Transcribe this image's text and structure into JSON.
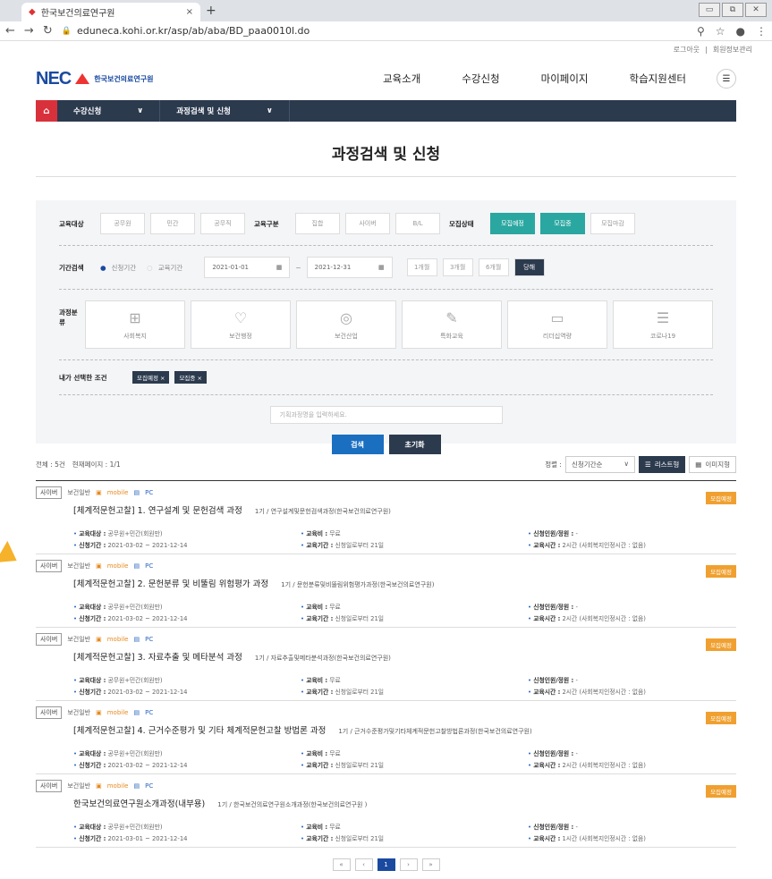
{
  "browser": {
    "tab_title": "한국보건의료연구원",
    "tab_close": "×",
    "new_tab": "+",
    "url": "eduneca.kohi.or.kr/asp/ab/aba/BD_paa0010l.do",
    "win_buttons": [
      "▭",
      "⧉",
      "✕"
    ]
  },
  "util": {
    "logout": "로그아웃",
    "sep": "|",
    "mypage": "회원정보관리"
  },
  "header": {
    "logo_text": "NEC",
    "logo_kor": "한국보건의료연구원",
    "menu": [
      "교육소개",
      "수강신청",
      "마이페이지",
      "학습지원센터"
    ]
  },
  "lnb": {
    "home": "⌂",
    "items": [
      "수강신청",
      "과정검색 및 신청"
    ],
    "chev": "∨"
  },
  "page_title": "과정검색 및 신청",
  "filter": {
    "target_label": "교육대상",
    "target_opts": [
      "공무원",
      "민간",
      "공무직"
    ],
    "type_label": "교육구분",
    "type_opts": [
      "집합",
      "사이버",
      "B/L"
    ],
    "status_label": "모집상태",
    "status_opts": [
      "모집예정",
      "모집중",
      "모집마감"
    ],
    "period_label": "기간검색",
    "period_radio1": "신청기간",
    "period_radio2": "교육기간",
    "date_from": "2021-01-01",
    "date_sep": "~",
    "date_to": "2021-12-31",
    "range_opts": [
      "1개월",
      "3개월",
      "6개월",
      "당해"
    ],
    "cat_label": "과정분류",
    "cats": [
      "사회복지",
      "보건행정",
      "보건산업",
      "특화교육",
      "리더십역량",
      "코로나19"
    ],
    "selected_label": "내가 선택한 조건",
    "chips": [
      "모집예정 ×",
      "모집중 ×"
    ],
    "search_placeholder": "기획과정명을 입력하세요.",
    "search_btn": "검색",
    "reset_btn": "초기화"
  },
  "listbar": {
    "total": "전체 : 5건",
    "page_info": "현재페이지 : 1/1",
    "sort_label": "정렬 :",
    "sort_value": "신청기간순",
    "view_list": "리스트형",
    "view_image": "이미지형"
  },
  "common": {
    "tag": "사이버",
    "category": "보건일반",
    "mobile": "mobile",
    "pc": "PC",
    "badge": "모집예정",
    "l_target": "교육대상 :",
    "l_period": "신청기간 :",
    "l_fee": "교육비 :",
    "l_edu": "교육기간 :",
    "l_cap": "신청인원/정원 :",
    "l_time": "교육시간 :"
  },
  "items": [
    {
      "title": "[체계적문헌고찰] 1. 연구설계 및 문헌검색 과정",
      "gi": "1기 / 연구설계및문헌검색과정(한국보건의료연구원)",
      "target": "공무원+민간(회원만)",
      "period": "2021-03-02 ~ 2021-12-14",
      "fee": "무료",
      "edu": "신청일로부터 21일",
      "cap": "-",
      "time": "2시간 (사회복지인정시간 : 없음)"
    },
    {
      "title": "[체계적문헌고찰] 2. 문헌분류 및 비뚤림 위험평가 과정",
      "gi": "1기 / 문헌분류및비뚤림위험평가과정(한국보건의료연구원)",
      "target": "공무원+민간(회원만)",
      "period": "2021-03-02 ~ 2021-12-14",
      "fee": "무료",
      "edu": "신청일로부터 21일",
      "cap": "-",
      "time": "2시간 (사회복지인정시간 : 없음)"
    },
    {
      "title": "[체계적문헌고찰] 3. 자료추출 및 메타분석 과정",
      "gi": "1기 / 자료추출및메타분석과정(한국보건의료연구원)",
      "target": "공무원+민간(회원만)",
      "period": "2021-03-02 ~ 2021-12-14",
      "fee": "무료",
      "edu": "신청일로부터 21일",
      "cap": "-",
      "time": "2시간 (사회복지인정시간 : 없음)"
    },
    {
      "title": "[체계적문헌고찰] 4. 근거수준평가 및 기타 체계적문헌고찰 방법론 과정",
      "gi": "1기 / 근거수준평가및기타체계적문헌고찰방법론과정(한국보건의료연구원)",
      "target": "공무원+민간(회원만)",
      "period": "2021-03-02 ~ 2021-12-14",
      "fee": "무료",
      "edu": "신청일로부터 21일",
      "cap": "-",
      "time": "2시간 (사회복지인정시간 : 없음)"
    },
    {
      "title": "한국보건의료연구원소개과정(내부용)",
      "gi": "1기 / 한국보건의료연구원소개과정(한국보건의료연구원 )",
      "target": "공무원+민간(회원만)",
      "period": "2021-03-01 ~ 2021-12-14",
      "fee": "무료",
      "edu": "신청일로부터 21일",
      "cap": "-",
      "time": "1시간 (사회복지인정시간 : 없음)"
    }
  ],
  "pager": [
    "«",
    "‹",
    "1",
    "›",
    "»"
  ],
  "colors": {
    "teal": "#2aa7a0",
    "navy": "#2c3a4e",
    "orange": "#f0a030",
    "blue": "#1a4aa0"
  }
}
